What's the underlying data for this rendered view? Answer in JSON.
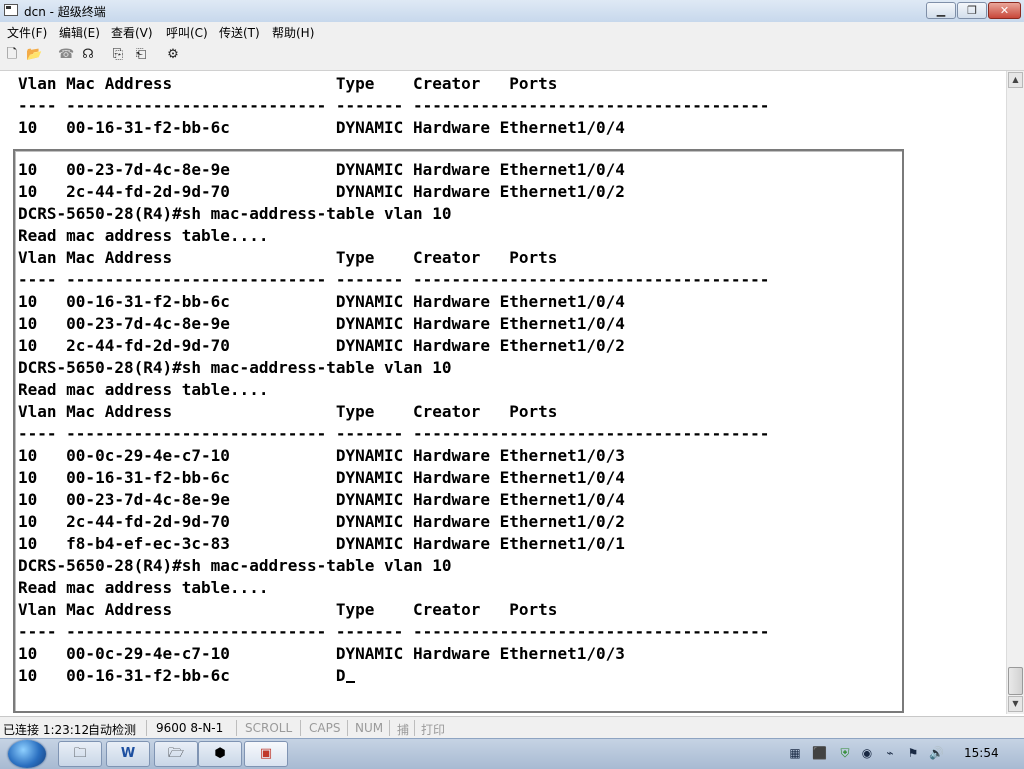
{
  "window": {
    "title": "dcn - 超级终端"
  },
  "menu": [
    "文件(F)",
    "编辑(E)",
    "查看(V)",
    "呼叫(C)",
    "传送(T)",
    "帮助(H)"
  ],
  "toolbar_icons": [
    "new-file-icon",
    "open-folder-icon",
    "phone-icon",
    "disconnect-icon",
    "send-icon",
    "receive-icon",
    "properties-icon"
  ],
  "terminal": {
    "top_lines": [
      "Vlan Mac Address                 Type    Creator   Ports",
      "---- --------------------------- ------- -------------------------------------",
      "10   00-16-31-f2-bb-6c           DYNAMIC Hardware Ethernet1/0/4"
    ],
    "lines": [
      "10   00-23-7d-4c-8e-9e           DYNAMIC Hardware Ethernet1/0/4",
      "10   2c-44-fd-2d-9d-70           DYNAMIC Hardware Ethernet1/0/2",
      "DCRS-5650-28(R4)#sh mac-address-table vlan 10",
      "Read mac address table....",
      "Vlan Mac Address                 Type    Creator   Ports",
      "---- --------------------------- ------- -------------------------------------",
      "10   00-16-31-f2-bb-6c           DYNAMIC Hardware Ethernet1/0/4",
      "10   00-23-7d-4c-8e-9e           DYNAMIC Hardware Ethernet1/0/4",
      "10   2c-44-fd-2d-9d-70           DYNAMIC Hardware Ethernet1/0/2",
      "DCRS-5650-28(R4)#sh mac-address-table vlan 10",
      "Read mac address table....",
      "Vlan Mac Address                 Type    Creator   Ports",
      "---- --------------------------- ------- -------------------------------------",
      "10   00-0c-29-4e-c7-10           DYNAMIC Hardware Ethernet1/0/3",
      "10   00-16-31-f2-bb-6c           DYNAMIC Hardware Ethernet1/0/4",
      "10   00-23-7d-4c-8e-9e           DYNAMIC Hardware Ethernet1/0/4",
      "10   2c-44-fd-2d-9d-70           DYNAMIC Hardware Ethernet1/0/2",
      "10   f8-b4-ef-ec-3c-83           DYNAMIC Hardware Ethernet1/0/1",
      "DCRS-5650-28(R4)#sh mac-address-table vlan 10",
      "Read mac address table....",
      "Vlan Mac Address                 Type    Creator   Ports",
      "---- --------------------------- ------- -------------------------------------",
      "10   00-0c-29-4e-c7-10           DYNAMIC Hardware Ethernet1/0/3"
    ],
    "last_line": "10   00-16-31-f2-bb-6c           D"
  },
  "status": {
    "connected": "已连接 1:23:12",
    "detect": "自动检测",
    "baud": "9600 8-N-1",
    "scroll": "SCROLL",
    "caps": "CAPS",
    "num": "NUM",
    "capture": "捕",
    "print": "打印"
  },
  "clock": "15:54"
}
